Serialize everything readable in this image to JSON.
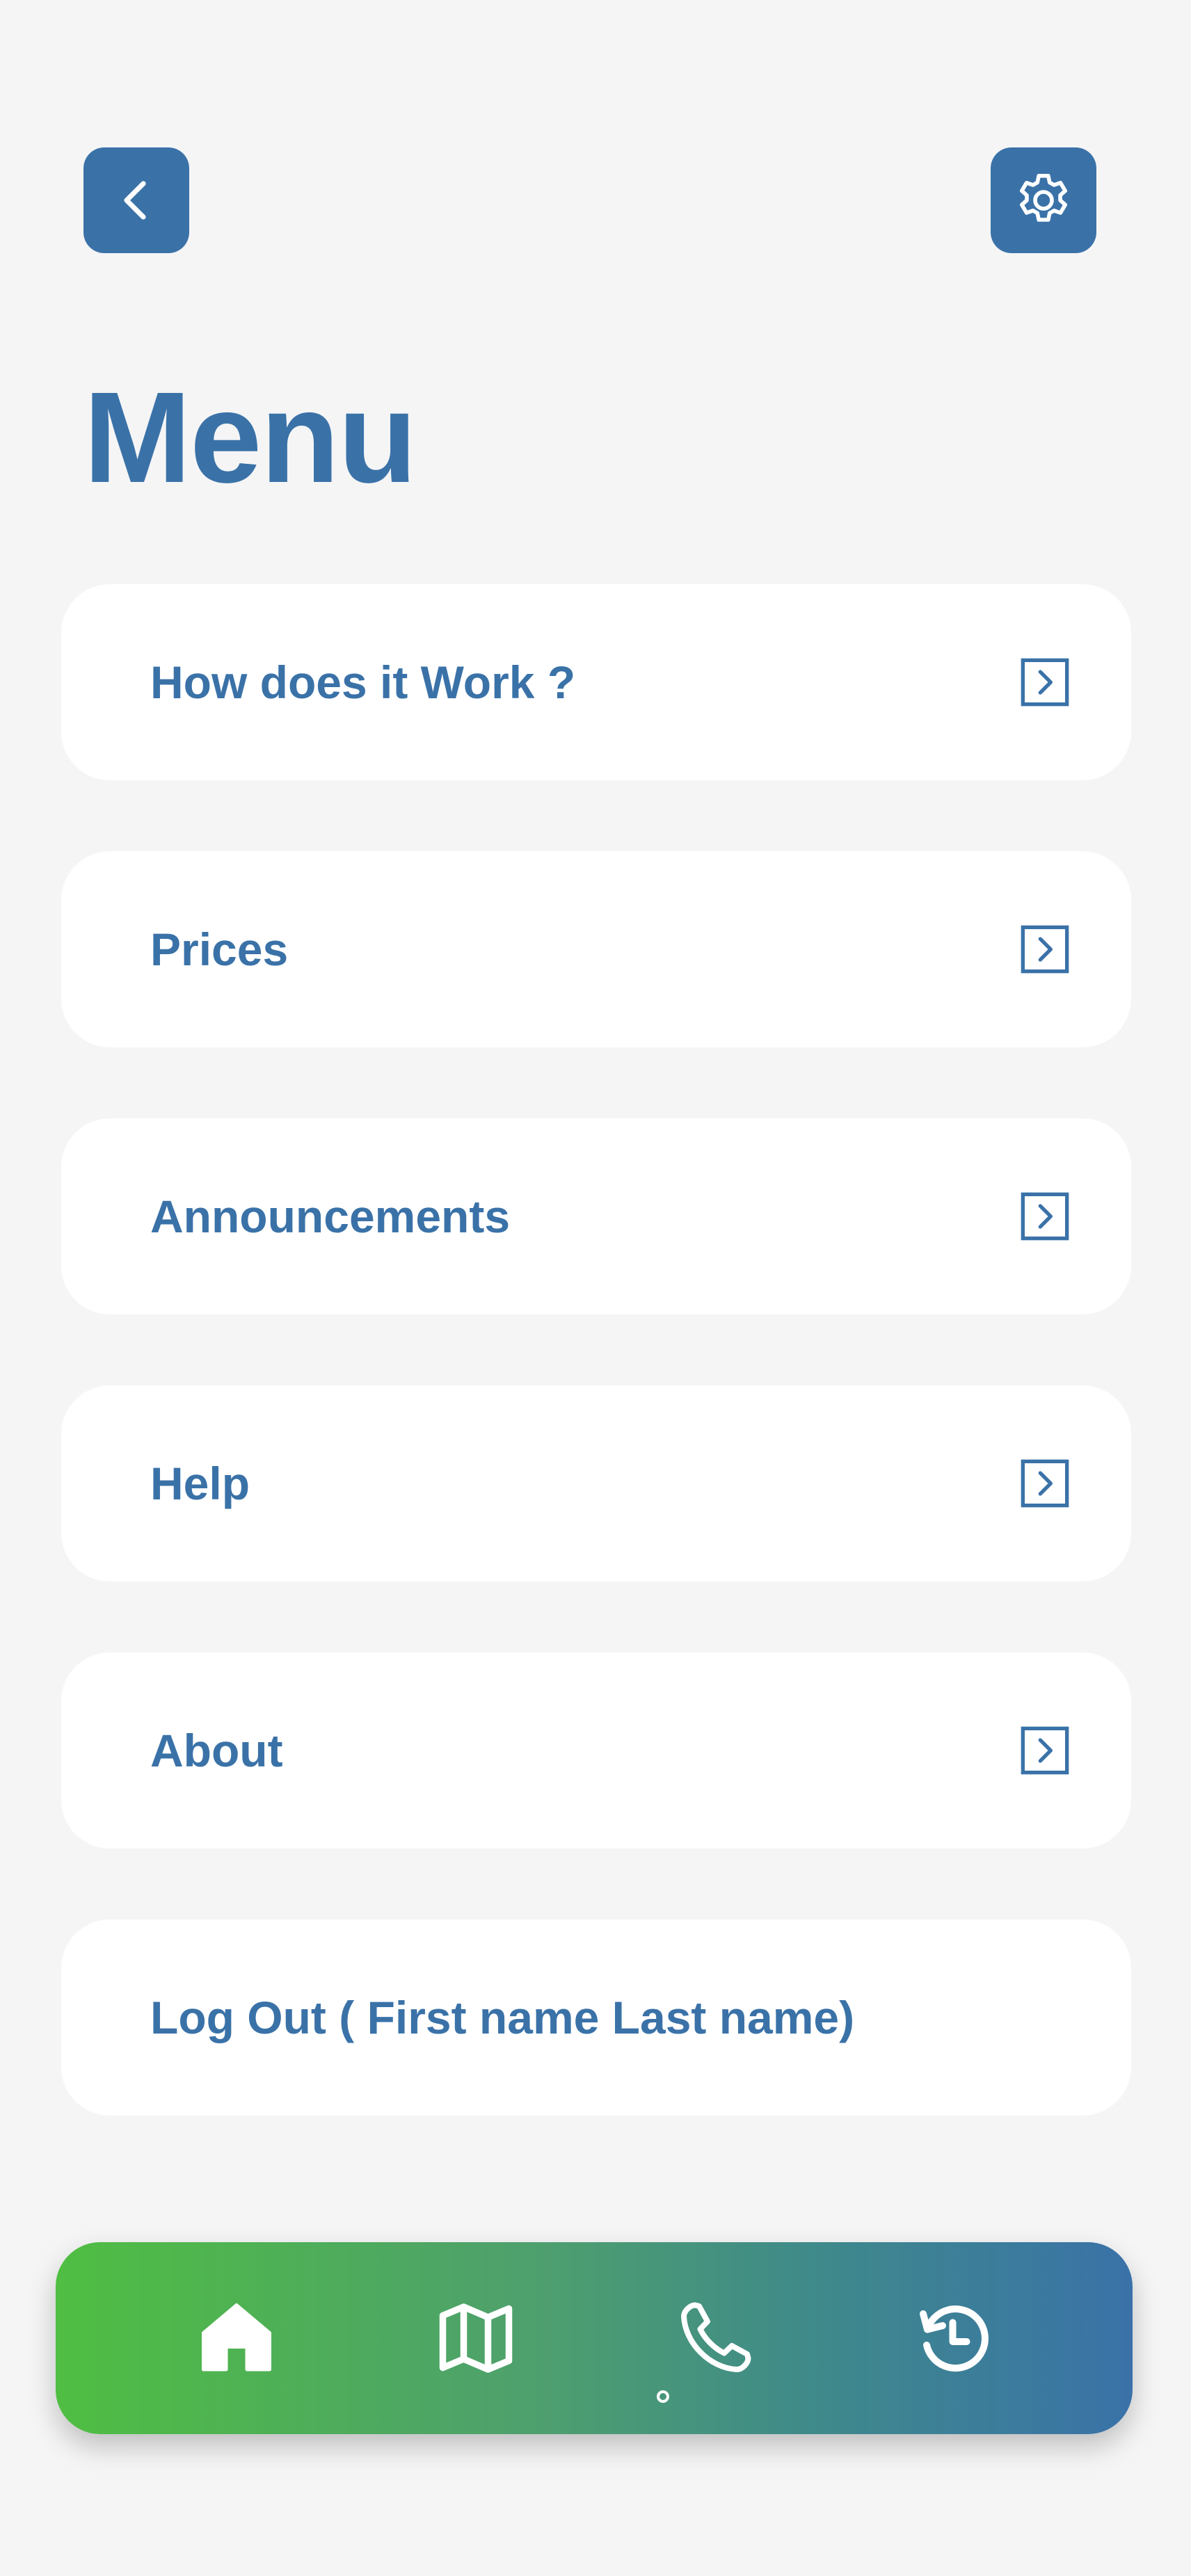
{
  "header": {
    "back_icon": "chevron-left-icon",
    "settings_icon": "gear-icon",
    "title": "Menu"
  },
  "menu": {
    "items": [
      {
        "label": "How does it Work ?",
        "icon": "arrow-right-square-icon"
      },
      {
        "label": "Prices",
        "icon": "arrow-right-square-icon"
      },
      {
        "label": "Announcements",
        "icon": "arrow-right-square-icon"
      },
      {
        "label": "Help",
        "icon": "arrow-right-square-icon"
      },
      {
        "label": "About",
        "icon": "arrow-right-square-icon"
      },
      {
        "label": "Log Out ( First name Last name)"
      }
    ]
  },
  "bottom_nav": {
    "items": [
      {
        "icon": "home-icon"
      },
      {
        "icon": "map-icon"
      },
      {
        "icon": "phone-icon",
        "active": true
      },
      {
        "icon": "history-icon"
      }
    ]
  },
  "colors": {
    "accent": "#3a72a8",
    "background": "#f5f5f6",
    "card": "#ffffff",
    "gradient_start": "#4fbe42",
    "gradient_end": "#3a72a8"
  }
}
